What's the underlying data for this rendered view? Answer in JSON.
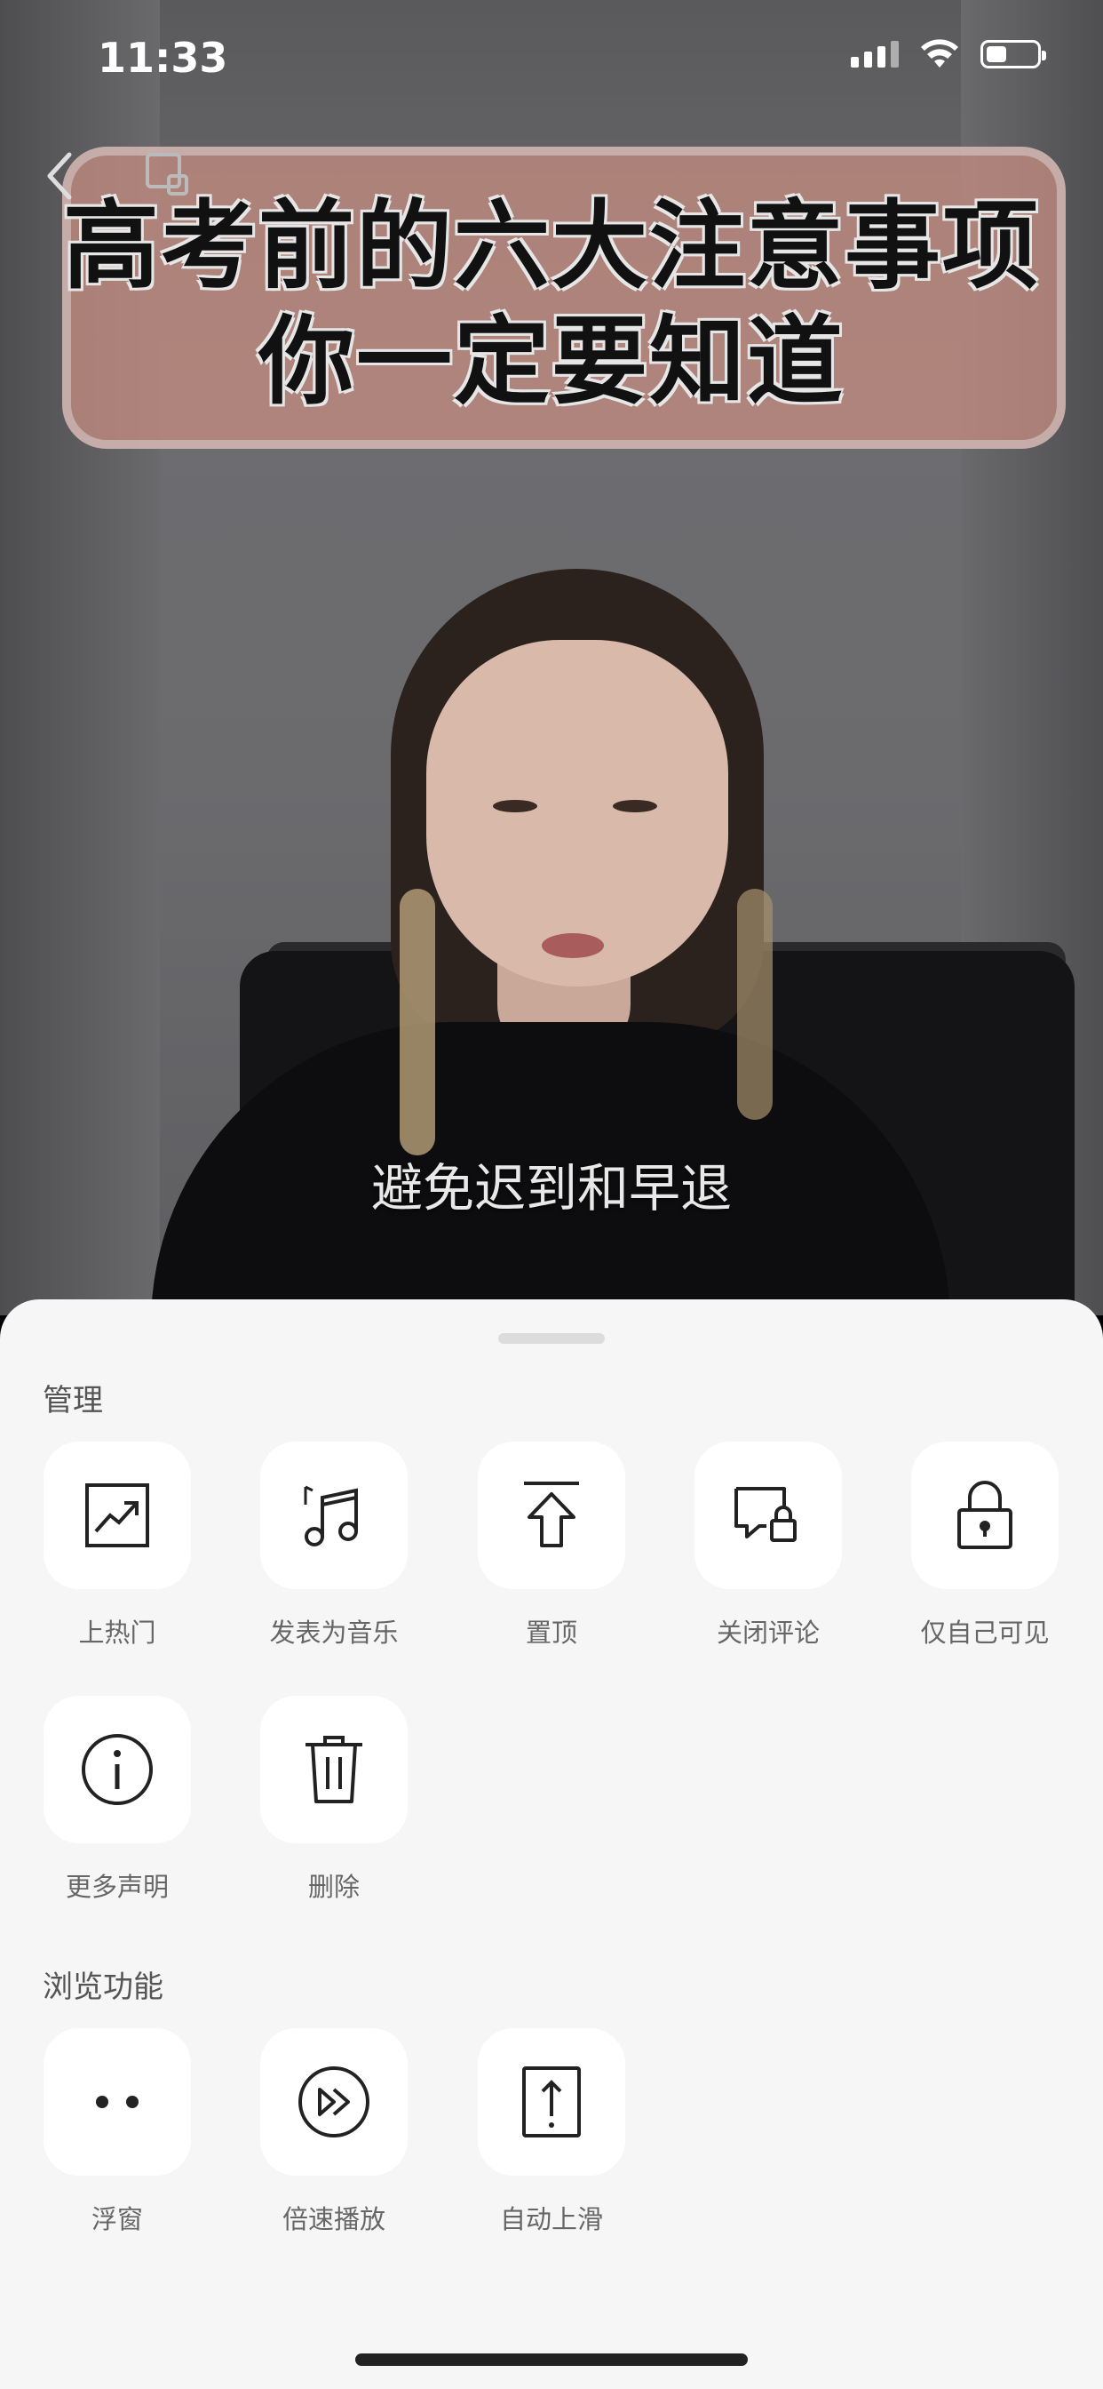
{
  "status_bar": {
    "time": "11:33"
  },
  "video": {
    "title_line1": "高考前的六大注意事项",
    "title_line2": "你一定要知道",
    "subtitle": "避免迟到和早退"
  },
  "sheet": {
    "section_manage": "管理",
    "section_browse": "浏览功能",
    "manage_items": [
      {
        "label": "上热门",
        "icon": "trending-up-icon"
      },
      {
        "label": "发表为音乐",
        "icon": "music-note-icon"
      },
      {
        "label": "置顶",
        "icon": "pin-top-icon"
      },
      {
        "label": "关闭评论",
        "icon": "comment-lock-icon"
      },
      {
        "label": "仅自己可见",
        "icon": "lock-icon"
      },
      {
        "label": "更多声明",
        "icon": "info-icon"
      },
      {
        "label": "删除",
        "icon": "trash-icon"
      }
    ],
    "browse_items": [
      {
        "label": "浮窗",
        "icon": "floating-window-icon"
      },
      {
        "label": "倍速播放",
        "icon": "fast-forward-icon"
      },
      {
        "label": "自动上滑",
        "icon": "auto-scroll-up-icon"
      }
    ]
  }
}
